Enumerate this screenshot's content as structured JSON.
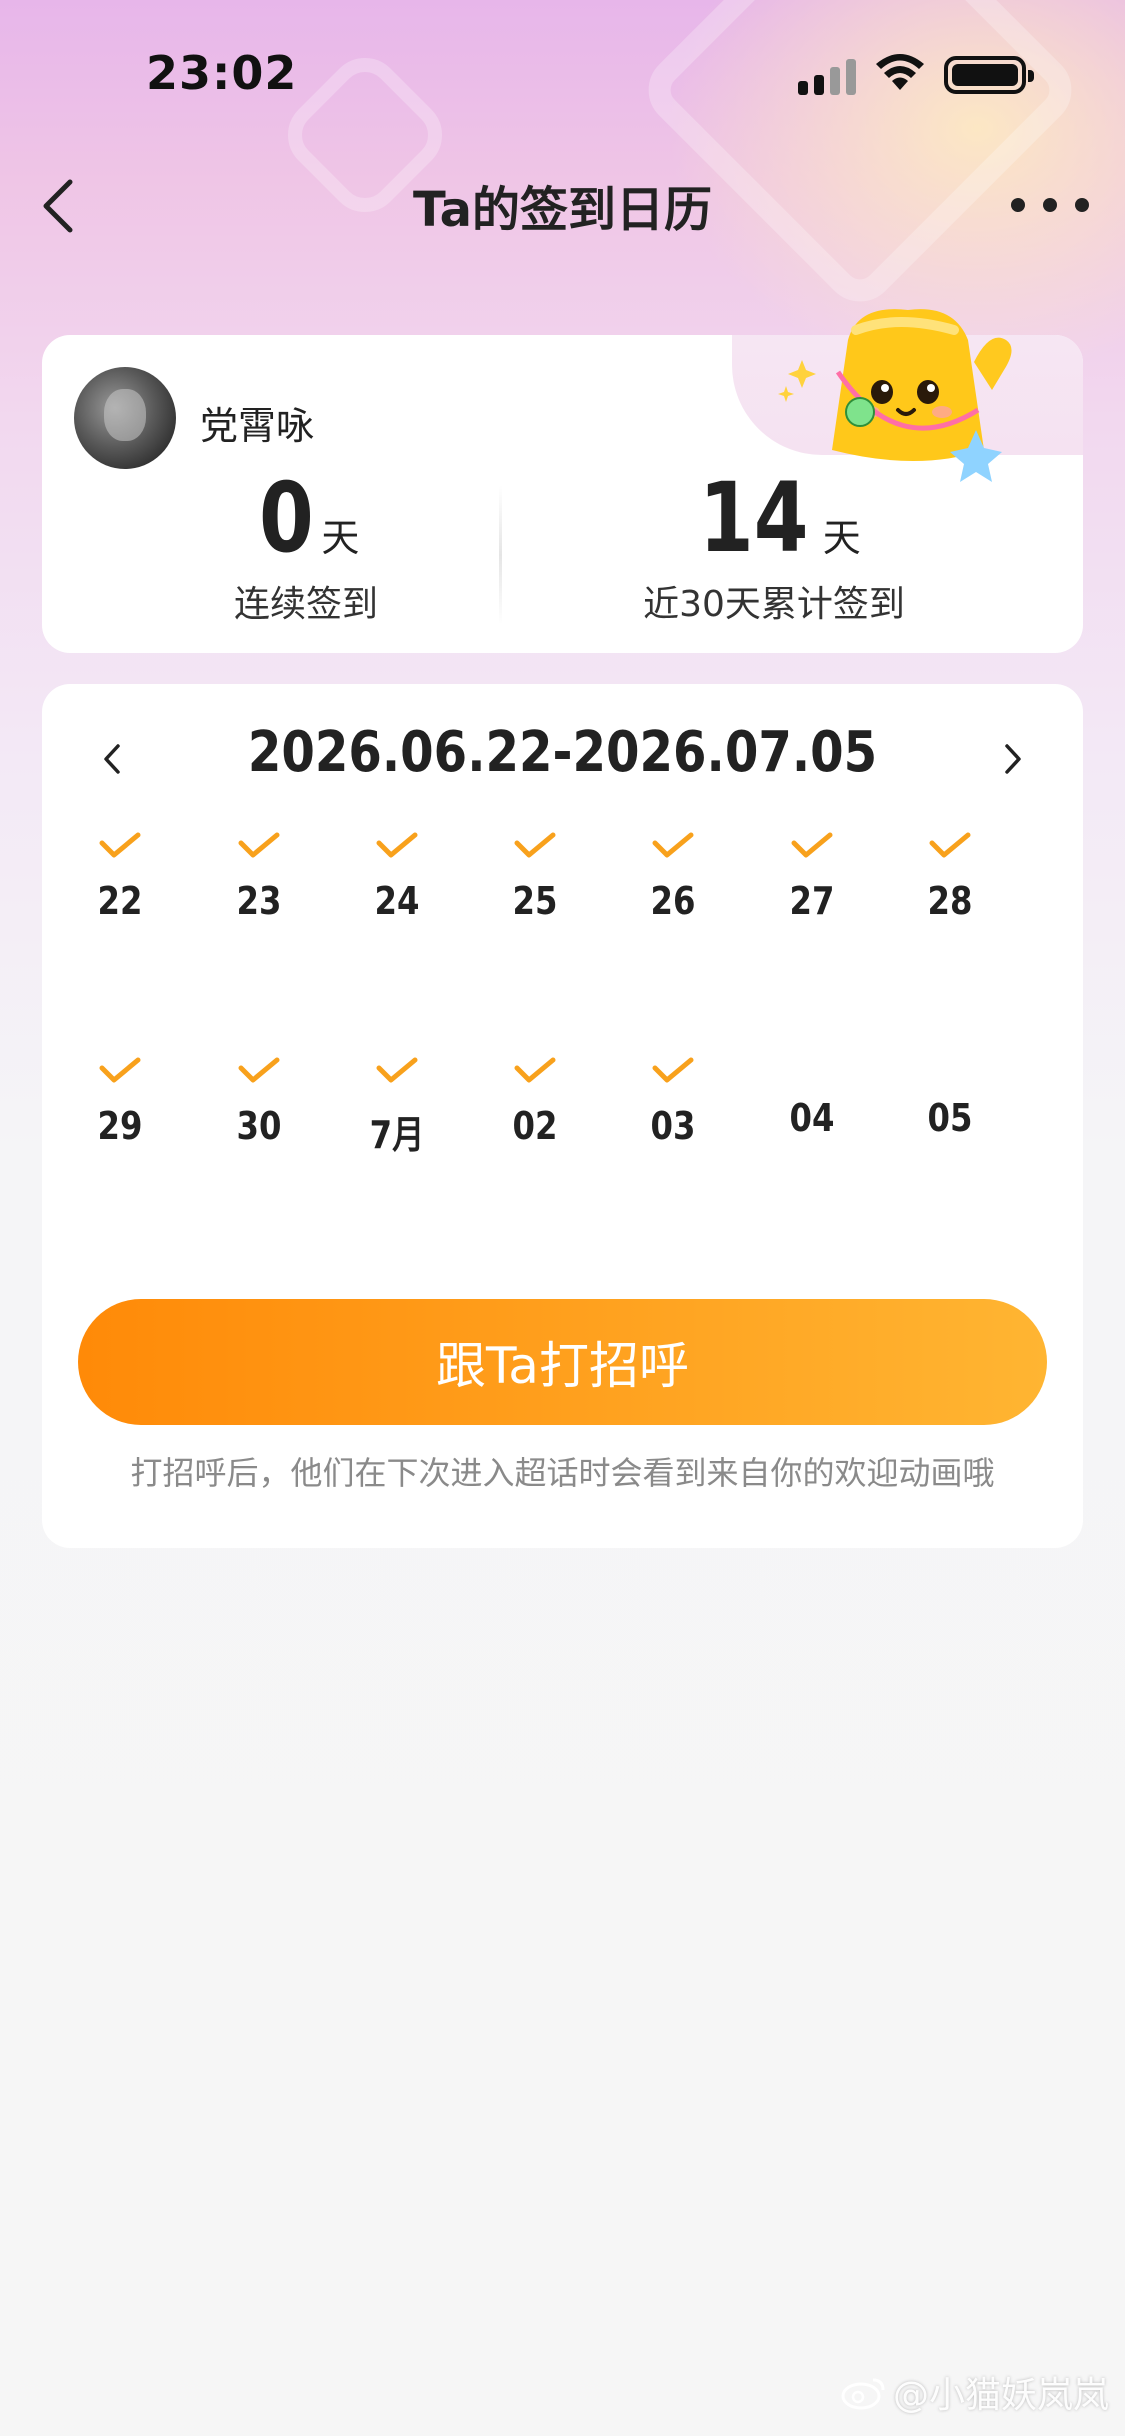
{
  "status_bar": {
    "time": "23:02"
  },
  "nav": {
    "title": "Ta的签到日历"
  },
  "profile": {
    "name": "党霄咏",
    "streak": {
      "value": "0",
      "unit": "天",
      "label": "连续签到"
    },
    "total": {
      "value": "14",
      "unit": "天",
      "label": "近30天累计签到"
    }
  },
  "calendar": {
    "range": "2026.06.22-2026.07.05",
    "days": [
      {
        "label": "22",
        "checked": true
      },
      {
        "label": "23",
        "checked": true
      },
      {
        "label": "24",
        "checked": true
      },
      {
        "label": "25",
        "checked": true
      },
      {
        "label": "26",
        "checked": true
      },
      {
        "label": "27",
        "checked": true
      },
      {
        "label": "28",
        "checked": true
      },
      {
        "label": "29",
        "checked": true
      },
      {
        "label": "30",
        "checked": true
      },
      {
        "label": "7月",
        "checked": true
      },
      {
        "label": "02",
        "checked": true
      },
      {
        "label": "03",
        "checked": true
      },
      {
        "label": "04",
        "checked": false
      },
      {
        "label": "05",
        "checked": false
      }
    ]
  },
  "action": {
    "button_label": "跟Ta打招呼",
    "hint": "打招呼后，他们在下次进入超话时会看到来自你的欢迎动画哦"
  },
  "watermark": "@小猫妖岚岚",
  "colors": {
    "accent": "#ff9a17",
    "check": "#f8a11c"
  }
}
